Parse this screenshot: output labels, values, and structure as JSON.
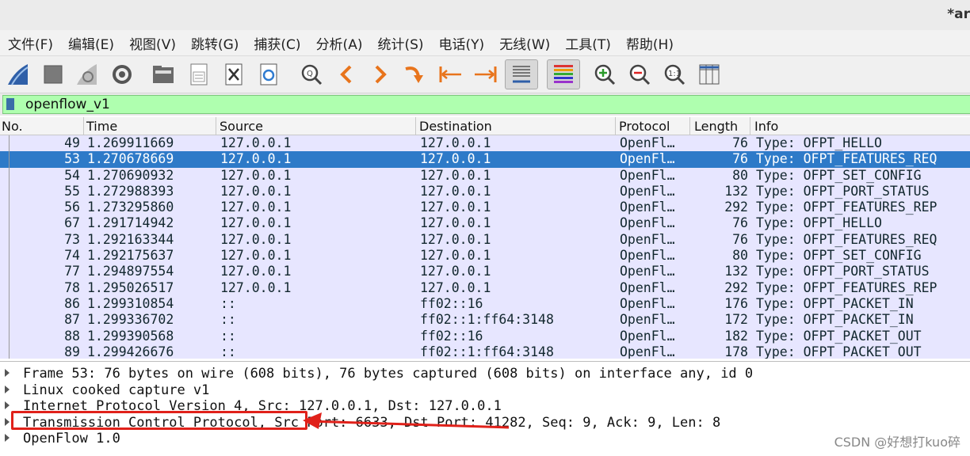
{
  "window": {
    "title": "*ar"
  },
  "menu": [
    "文件(F)",
    "编辑(E)",
    "视图(V)",
    "跳转(G)",
    "捕获(C)",
    "分析(A)",
    "统计(S)",
    "电话(Y)",
    "无线(W)",
    "工具(T)",
    "帮助(H)"
  ],
  "toolbar": {
    "icons": [
      "shark-fin-icon",
      "stop-square-icon",
      "restart-fin-icon",
      "gear-icon",
      "folder-icon",
      "save-file-icon",
      "close-file-icon",
      "reload-file-icon",
      "find-icon",
      "back-arrow-icon",
      "forward-arrow-icon",
      "goto-packet-icon",
      "first-packet-icon",
      "last-packet-icon",
      "autoscroll-icon",
      "colorize-icon",
      "zoom-in-icon",
      "zoom-out-icon",
      "zoom-normal-icon",
      "resize-columns-icon"
    ]
  },
  "filter": {
    "value": "openflow_v1",
    "accent": "#afffaf"
  },
  "packet_list": {
    "columns": [
      "No.",
      "Time",
      "Source",
      "Destination",
      "Protocol",
      "Length",
      "Info"
    ],
    "rows": [
      {
        "no": "49",
        "time": "1.269911669",
        "src": "127.0.0.1",
        "dst": "127.0.0.1",
        "proto": "OpenFl…",
        "len": "76",
        "info": "Type: OFPT_HELLO",
        "selected": false
      },
      {
        "no": "53",
        "time": "1.270678669",
        "src": "127.0.0.1",
        "dst": "127.0.0.1",
        "proto": "OpenFl…",
        "len": "76",
        "info": "Type: OFPT_FEATURES_REQ",
        "selected": true
      },
      {
        "no": "54",
        "time": "1.270690932",
        "src": "127.0.0.1",
        "dst": "127.0.0.1",
        "proto": "OpenFl…",
        "len": "80",
        "info": "Type: OFPT_SET_CONFIG",
        "selected": false
      },
      {
        "no": "55",
        "time": "1.272988393",
        "src": "127.0.0.1",
        "dst": "127.0.0.1",
        "proto": "OpenFl…",
        "len": "132",
        "info": "Type: OFPT_PORT_STATUS",
        "selected": false
      },
      {
        "no": "56",
        "time": "1.273295860",
        "src": "127.0.0.1",
        "dst": "127.0.0.1",
        "proto": "OpenFl…",
        "len": "292",
        "info": "Type: OFPT_FEATURES_REP",
        "selected": false
      },
      {
        "no": "67",
        "time": "1.291714942",
        "src": "127.0.0.1",
        "dst": "127.0.0.1",
        "proto": "OpenFl…",
        "len": "76",
        "info": "Type: OFPT_HELLO",
        "selected": false
      },
      {
        "no": "73",
        "time": "1.292163344",
        "src": "127.0.0.1",
        "dst": "127.0.0.1",
        "proto": "OpenFl…",
        "len": "76",
        "info": "Type: OFPT_FEATURES_REQ",
        "selected": false
      },
      {
        "no": "74",
        "time": "1.292175637",
        "src": "127.0.0.1",
        "dst": "127.0.0.1",
        "proto": "OpenFl…",
        "len": "80",
        "info": "Type: OFPT_SET_CONFIG",
        "selected": false
      },
      {
        "no": "77",
        "time": "1.294897554",
        "src": "127.0.0.1",
        "dst": "127.0.0.1",
        "proto": "OpenFl…",
        "len": "132",
        "info": "Type: OFPT_PORT_STATUS",
        "selected": false
      },
      {
        "no": "78",
        "time": "1.295026517",
        "src": "127.0.0.1",
        "dst": "127.0.0.1",
        "proto": "OpenFl…",
        "len": "292",
        "info": "Type: OFPT_FEATURES_REP",
        "selected": false
      },
      {
        "no": "86",
        "time": "1.299310854",
        "src": "::",
        "dst": "ff02::16",
        "proto": "OpenFl…",
        "len": "176",
        "info": "Type: OFPT_PACKET_IN",
        "selected": false
      },
      {
        "no": "87",
        "time": "1.299336702",
        "src": "::",
        "dst": "ff02::1:ff64:3148",
        "proto": "OpenFl…",
        "len": "172",
        "info": "Type: OFPT_PACKET_IN",
        "selected": false
      },
      {
        "no": "88",
        "time": "1.299390568",
        "src": "::",
        "dst": "ff02::16",
        "proto": "OpenFl…",
        "len": "182",
        "info": "Type: OFPT_PACKET_OUT",
        "selected": false
      },
      {
        "no": "89",
        "time": "1.299426676",
        "src": "::",
        "dst": "ff02::1:ff64:3148",
        "proto": "OpenFl…",
        "len": "178",
        "info": "Type: OFPT_PACKET_OUT",
        "selected": false
      }
    ],
    "row_color": "#e7e6ff",
    "selected_color": "#2e7ac8"
  },
  "details": [
    "Frame 53: 76 bytes on wire (608 bits), 76 bytes captured (608 bits) on interface any, id 0",
    "Linux cooked capture v1",
    "Internet Protocol Version 4, Src: 127.0.0.1, Dst: 127.0.0.1",
    "Transmission Control Protocol, Src Port: 6633, Dst Port: 41282, Seq: 9, Ack: 9, Len: 8",
    "OpenFlow 1.0"
  ],
  "annotation": {
    "color": "#e0211a"
  },
  "watermark": "CSDN @好想打kuo碎"
}
